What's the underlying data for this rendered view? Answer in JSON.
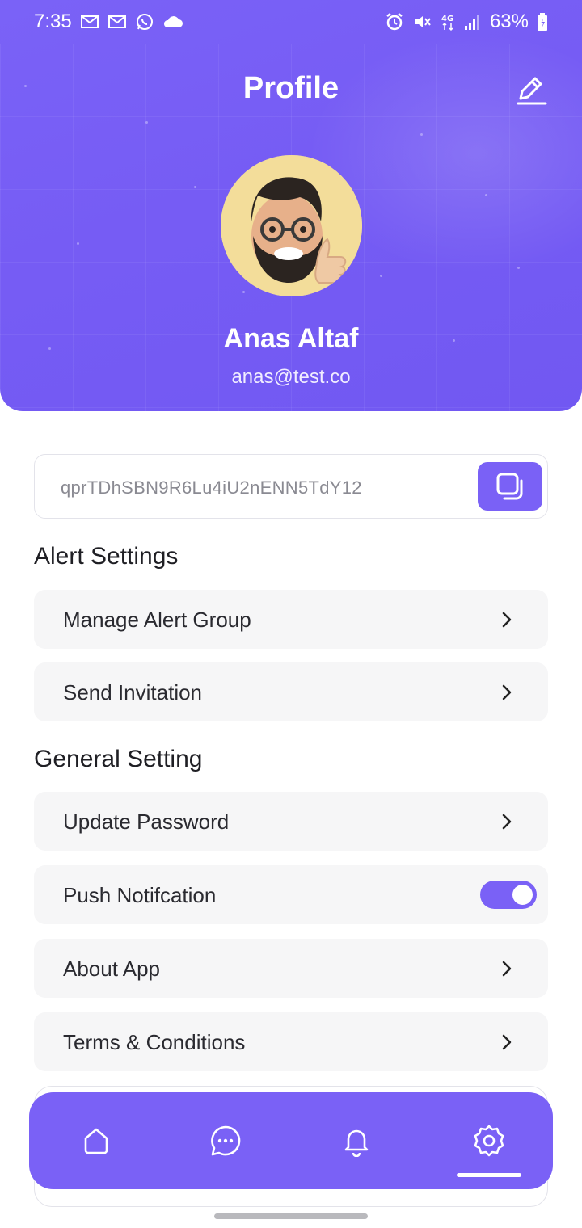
{
  "status_bar": {
    "time": "7:35",
    "battery": "63%",
    "network": "4G",
    "icons": [
      "gmail-icon",
      "gmail-icon",
      "whatsapp-icon",
      "cloud-icon",
      "alarm-icon",
      "mute-icon",
      "network-icon",
      "signal-icon",
      "battery-icon"
    ]
  },
  "header": {
    "title": "Profile",
    "user_name": "Anas Altaf",
    "user_email": "anas@test.co",
    "edit_icon": "edit-icon"
  },
  "referral": {
    "code": "qprTDhSBN9R6Lu4iU2nENN5TdY12",
    "copy_icon": "copy-icon"
  },
  "alert_settings": {
    "title": "Alert Settings",
    "items": [
      {
        "label": "Manage Alert Group"
      },
      {
        "label": "Send Invitation"
      }
    ]
  },
  "general_setting": {
    "title": "General Setting",
    "items": [
      {
        "label": "Update Password"
      },
      {
        "label": "Push Notifcation",
        "toggle": true
      },
      {
        "label": "About App"
      },
      {
        "label": "Terms & Conditions"
      }
    ]
  },
  "tabbar": {
    "tabs": [
      "home-icon",
      "chat-icon",
      "bell-icon",
      "settings-icon"
    ],
    "active": "settings"
  },
  "colors": {
    "accent": "#7a61f6",
    "row_bg": "#f6f6f7"
  }
}
